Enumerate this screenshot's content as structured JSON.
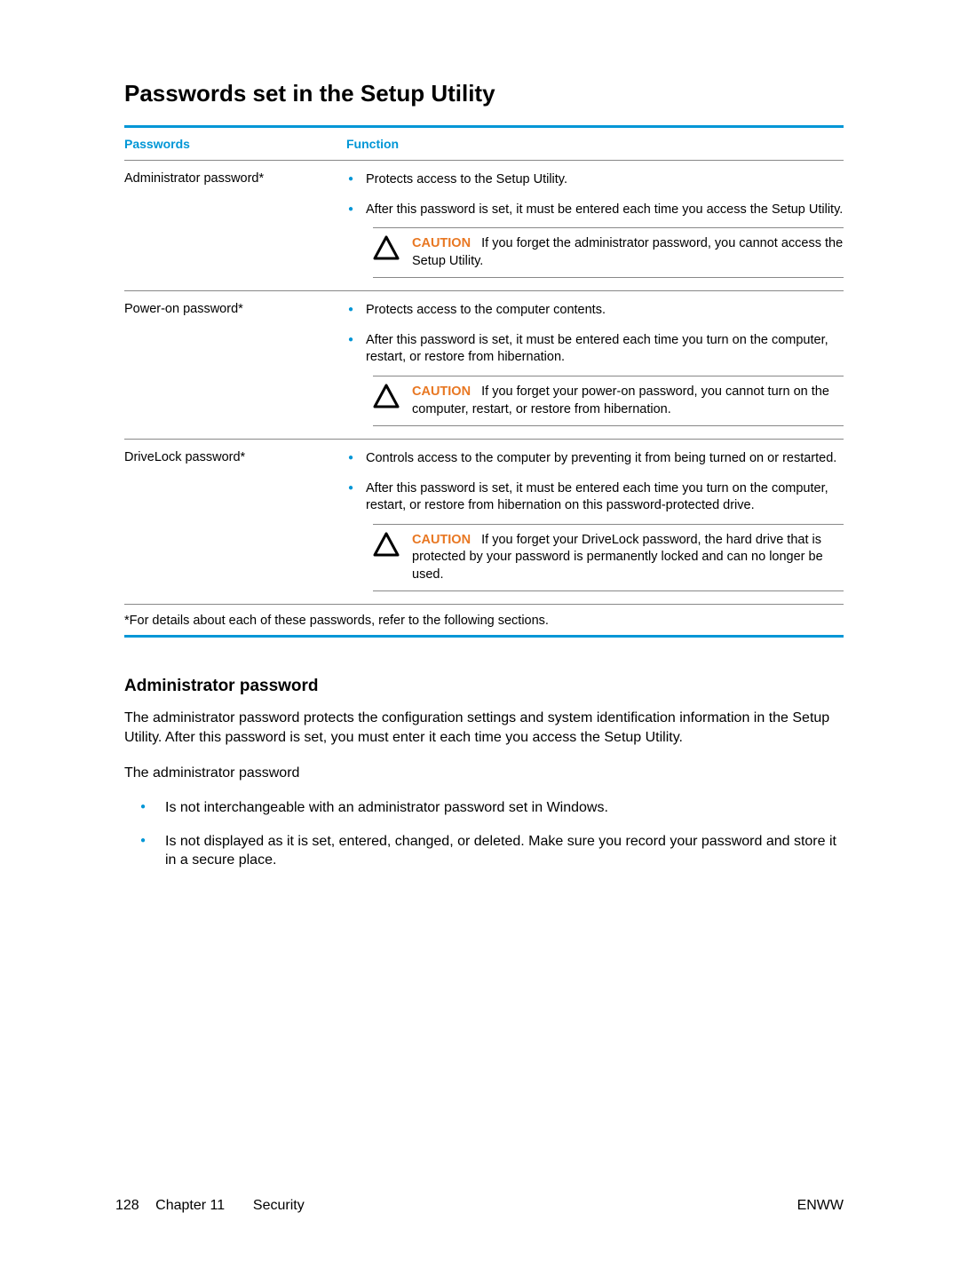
{
  "heading": "Passwords set in the Setup Utility",
  "table": {
    "headers": {
      "passwords": "Passwords",
      "function": "Function"
    },
    "rows": [
      {
        "name": "Administrator password*",
        "bullets": [
          "Protects access to the Setup Utility.",
          "After this password is set, it must be entered each time you access the Setup Utility."
        ],
        "caution_label": "CAUTION",
        "caution": "If you forget the administrator password, you cannot access the Setup Utility."
      },
      {
        "name": "Power-on password*",
        "bullets": [
          "Protects access to the computer contents.",
          "After this password is set, it must be entered each time you turn on the computer, restart, or restore from hibernation."
        ],
        "caution_label": "CAUTION",
        "caution": "If you forget your power-on password, you cannot turn on the computer, restart, or restore from hibernation."
      },
      {
        "name": "DriveLock password*",
        "bullets": [
          "Controls access to the computer by preventing it from being turned on or restarted.",
          "After this password is set, it must be entered each time you turn on the computer, restart, or restore from hibernation on this password-protected drive."
        ],
        "caution_label": "CAUTION",
        "caution": "If you forget your DriveLock password, the hard drive that is protected by your password is permanently locked and can no longer be used."
      }
    ],
    "footnote": "*For details about each of these passwords, refer to the following sections."
  },
  "section": {
    "heading": "Administrator password",
    "p1": "The administrator password protects the configuration settings and system identification information in the Setup Utility. After this password is set, you must enter it each time you access the Setup Utility.",
    "p2": "The administrator password",
    "bullets": [
      "Is not interchangeable with an administrator password set in Windows.",
      "Is not displayed as it is set, entered, changed, or deleted. Make sure you record your password and store it in a secure place."
    ]
  },
  "footer": {
    "page": "128",
    "chapter": "Chapter 11",
    "title": "Security",
    "right": "ENWW"
  }
}
